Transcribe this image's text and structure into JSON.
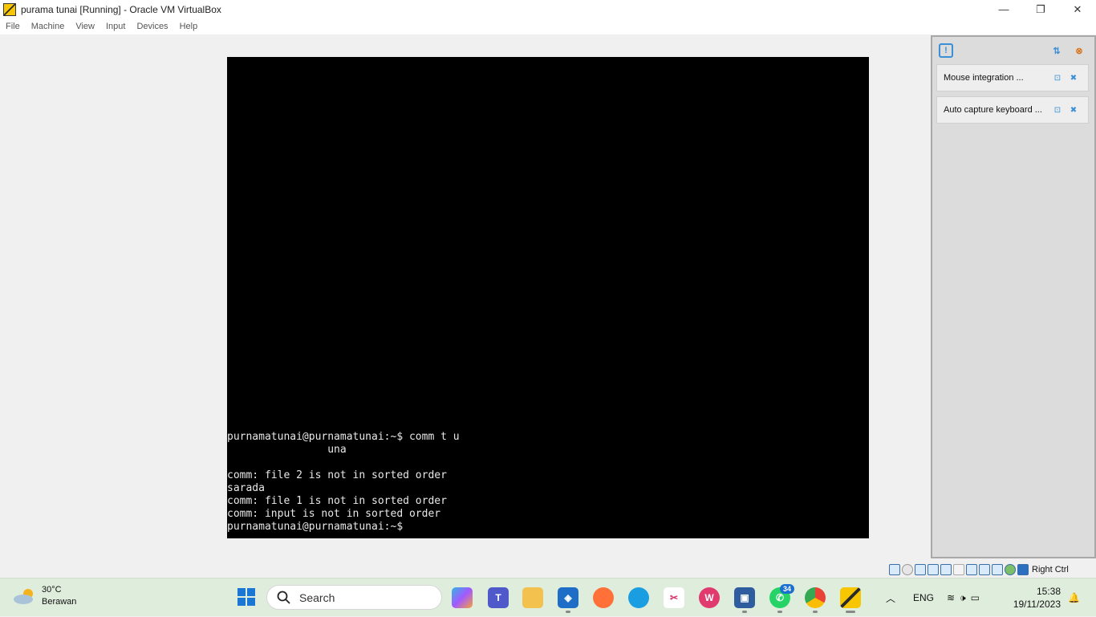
{
  "window": {
    "title": "purama tunai [Running] - Oracle VM VirtualBox",
    "minimize": "—",
    "maximize": "❐",
    "close": "✕"
  },
  "menu": [
    "File",
    "Machine",
    "View",
    "Input",
    "Devices",
    "Help"
  ],
  "terminal": {
    "lines": [
      "purnamatunai@purnamatunai:~$ comm t u",
      "                una",
      "",
      "comm: file 2 is not in sorted order",
      "sarada",
      "comm: file 1 is not in sorted order",
      "comm: input is not in sorted order",
      "purnamatunai@purnamatunai:~$"
    ]
  },
  "notifications": [
    {
      "text": "Mouse integration ..."
    },
    {
      "text": "Auto capture keyboard ..."
    }
  ],
  "status_bar": {
    "host_key": "Right Ctrl"
  },
  "taskbar": {
    "weather": {
      "temp": "30°C",
      "condition": "Berawan"
    },
    "search_label": "Search",
    "whatsapp_badge": "34",
    "language": "ENG",
    "time": "15:38",
    "date": "19/11/2023"
  },
  "colors": {
    "terminal_bg": "#000000",
    "terminal_fg": "#e8e8e8",
    "taskbar_bg": "#dfeedc",
    "accent": "#1a78d4"
  }
}
